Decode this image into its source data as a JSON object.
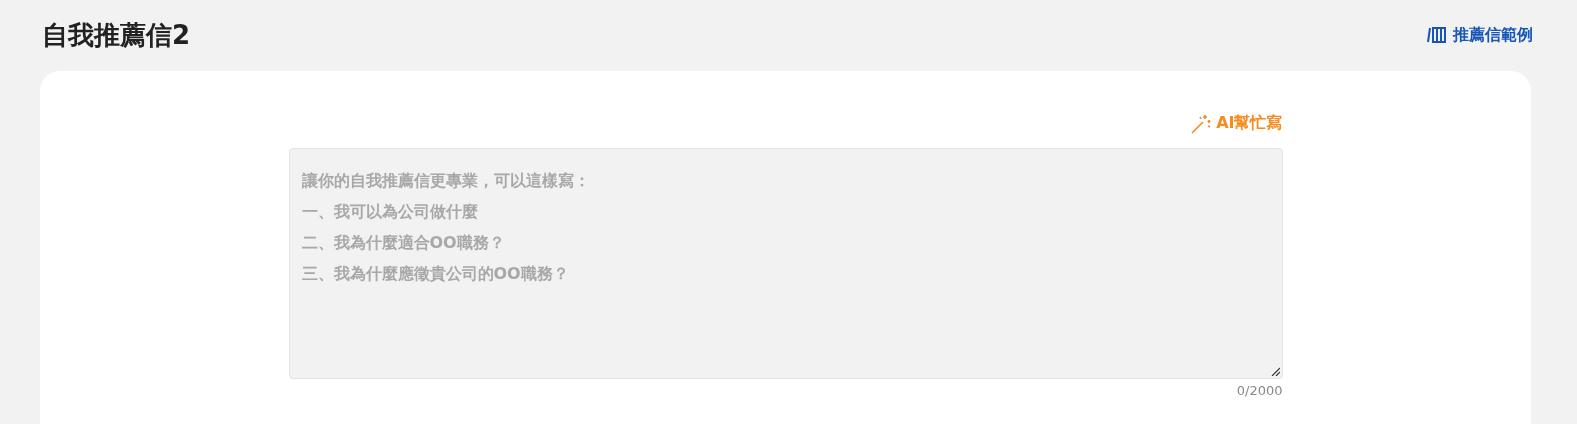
{
  "page_title": "自我推薦信2",
  "examples_link": {
    "label": "推薦信範例"
  },
  "ai_button": {
    "label": "AI幫忙寫"
  },
  "letter_field": {
    "placeholder": [
      "讓你的自我推薦信更專業，可以這樣寫：",
      "一、我可以為公司做什麼",
      "二、我為什麼適合OO職務？",
      "三、我為什麼應徵貴公司的OO職務？"
    ]
  },
  "char_count": "0/2000"
}
